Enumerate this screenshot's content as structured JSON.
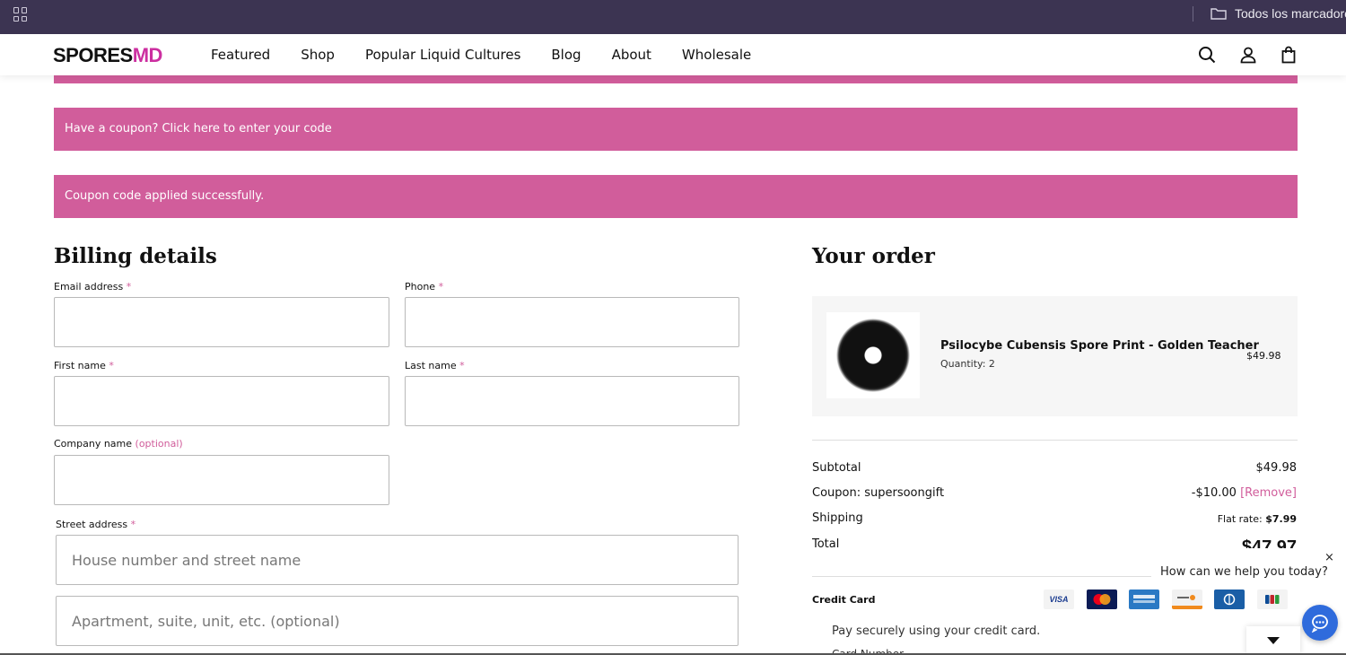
{
  "browser": {
    "bookmarks_folder": "Todos los marcadores",
    "icons": [
      "apps-grid-icon",
      "folder-icon"
    ]
  },
  "header": {
    "logo": {
      "main": "SPORES",
      "accent": "MD",
      "accent_color": "#cc2fa0"
    },
    "nav": [
      "Featured",
      "Shop",
      "Popular Liquid Cultures",
      "Blog",
      "About",
      "Wholesale"
    ],
    "icons": [
      "search-icon",
      "account-icon",
      "cart-icon"
    ]
  },
  "notices": {
    "coupon_prompt": "Have a coupon? Click here to enter your code",
    "coupon_success": "Coupon code applied successfully.",
    "color": "#d15d9b"
  },
  "billing": {
    "title": "Billing details",
    "required_mark": "*",
    "fields": {
      "email": {
        "label": "Email address",
        "value": ""
      },
      "phone": {
        "label": "Phone",
        "value": ""
      },
      "first_name": {
        "label": "First name",
        "value": ""
      },
      "last_name": {
        "label": "Last name",
        "value": ""
      },
      "company": {
        "label": "Company name",
        "optional": "(optional)",
        "value": ""
      },
      "street": {
        "label": "Street address",
        "placeholder_1": "House number and street name",
        "placeholder_2": "Apartment, suite, unit, etc. (optional)"
      }
    }
  },
  "order": {
    "title": "Your order",
    "item": {
      "name": "Psilocybe Cubensis Spore Print - Golden Teacher",
      "quantity": "Quantity: 2",
      "price": "$49.98"
    },
    "subtotal_label": "Subtotal",
    "subtotal_value": "$49.98",
    "coupon_label": "Coupon: supersoongift",
    "coupon_value": "-$10.00",
    "coupon_remove": "[Remove]",
    "shipping_label": "Shipping",
    "shipping_prefix": "Flat rate:",
    "shipping_value": "$7.99",
    "total_label": "Total",
    "total_value": "$47.97"
  },
  "payment": {
    "method": "Credit Card",
    "cards": [
      "VISA",
      "MC",
      "AMEX",
      "DISCOVER",
      "DINERS",
      "JCB"
    ],
    "description": "Pay securely using your credit card.",
    "next_label": "Card Number"
  },
  "chat": {
    "prompt": "How can we help you today?",
    "close": "×"
  }
}
